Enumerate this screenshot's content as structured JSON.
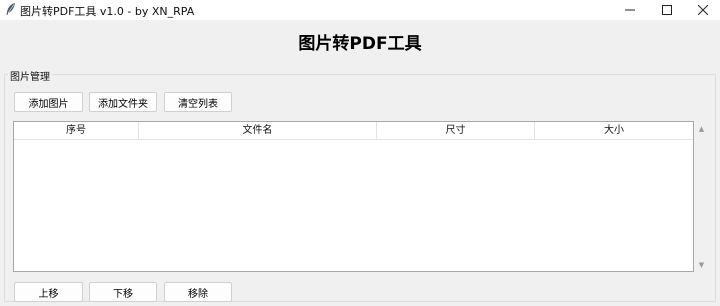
{
  "window": {
    "title": "图片转PDF工具 v1.0 - by XN_RPA",
    "minimize_icon": "minimize-icon",
    "maximize_icon": "maximize-icon",
    "close_icon": "close-icon"
  },
  "header": {
    "title": "图片转PDF工具"
  },
  "image_manager": {
    "group_label": "图片管理",
    "toolbar": {
      "add_image_label": "添加图片",
      "add_folder_label": "添加文件夹",
      "clear_list_label": "清空列表"
    },
    "table": {
      "columns": [
        "序号",
        "文件名",
        "尺寸",
        "大小"
      ],
      "rows": []
    },
    "actions": {
      "move_up_label": "上移",
      "move_down_label": "下移",
      "remove_label": "移除"
    }
  },
  "colors": {
    "window_bg": "#f0f0f0",
    "titlebar_bg": "#ffffff",
    "table_bg": "#ffffff",
    "table_border": "#a8a8a8"
  }
}
